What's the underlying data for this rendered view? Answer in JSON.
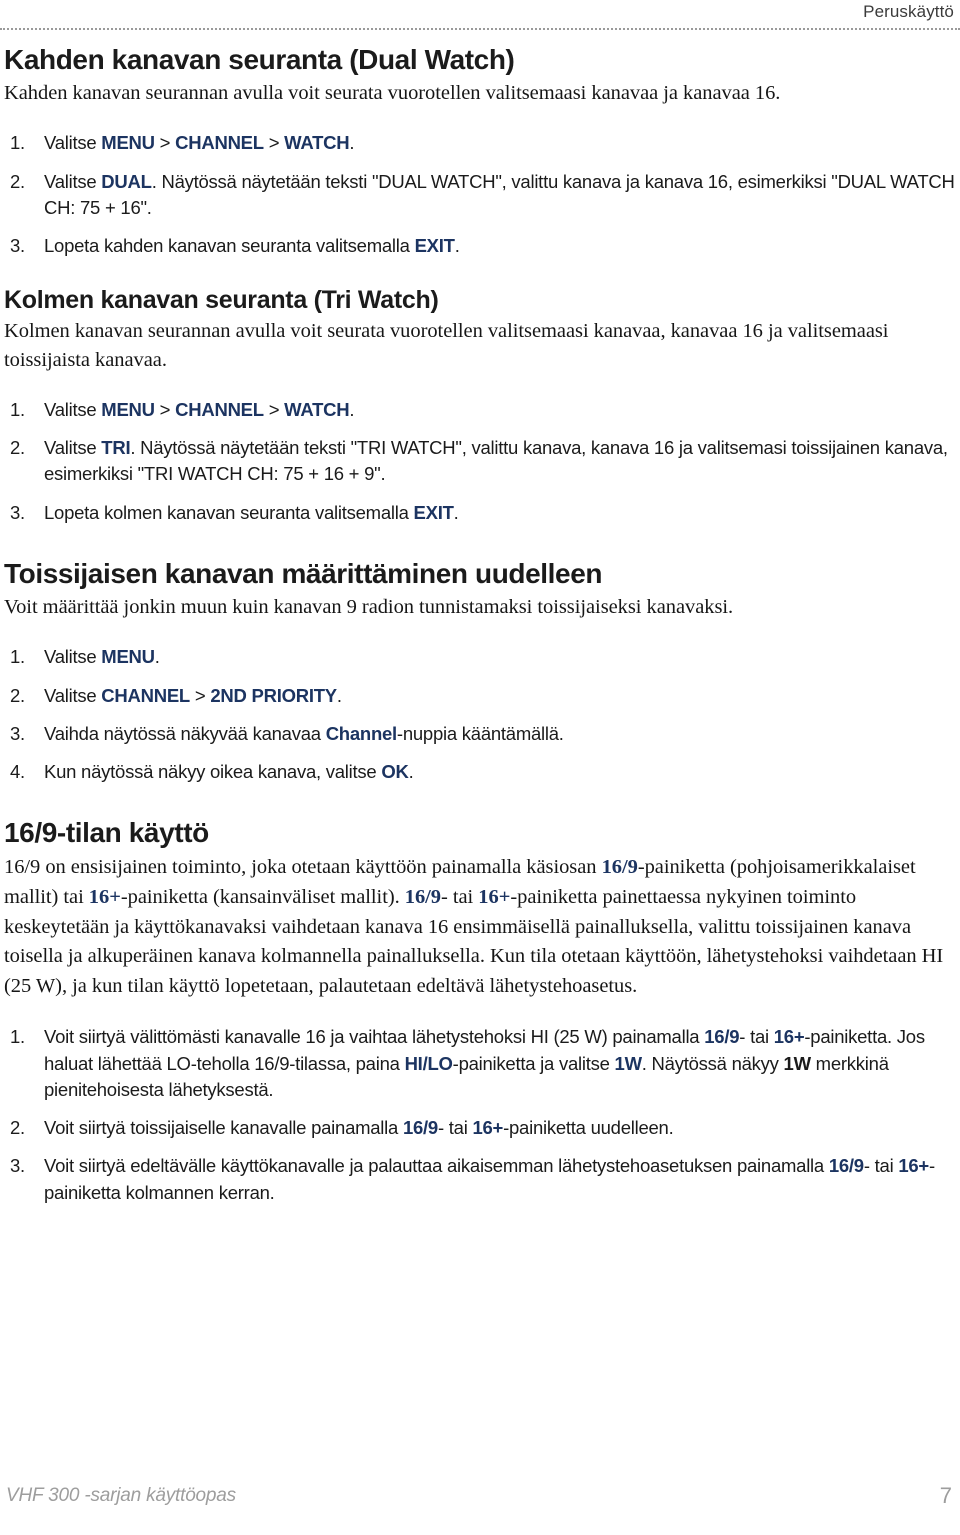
{
  "header": {
    "section_label": "Peruskäyttö"
  },
  "colors": {
    "keyword_blue": "#1c3461",
    "heading_black": "#1b1b1b",
    "footer_gray": "#9d9d9d",
    "rule_gray": "#9a9a9a"
  },
  "sections": [
    {
      "heading": "Kahden kanavan seuranta (Dual Watch)",
      "lead": "Kahden kanavan seurannan avulla voit seurata vuorotellen valitsemaasi kanavaa ja kanavaa 16.",
      "steps": [
        {
          "num": "1.",
          "parts": [
            {
              "t": "Valitse ",
              "k": false
            },
            {
              "t": "MENU",
              "k": true
            },
            {
              "t": " > ",
              "k": false
            },
            {
              "t": "CHANNEL",
              "k": true
            },
            {
              "t": " > ",
              "k": false
            },
            {
              "t": "WATCH",
              "k": true
            },
            {
              "t": ".",
              "k": false
            }
          ]
        },
        {
          "num": "2.",
          "parts": [
            {
              "t": "Valitse ",
              "k": false
            },
            {
              "t": "DUAL",
              "k": true
            },
            {
              "t": ". Näytössä näytetään teksti \"DUAL WATCH\", valittu kanava ja kanava 16, esimerkiksi \"DUAL WATCH CH: 75 + 16\".",
              "k": false
            }
          ]
        },
        {
          "num": "3.",
          "parts": [
            {
              "t": "Lopeta kahden kanavan seuranta valitsemalla ",
              "k": false
            },
            {
              "t": "EXIT",
              "k": true
            },
            {
              "t": ".",
              "k": false
            }
          ]
        }
      ]
    },
    {
      "heading": "Kolmen kanavan seuranta (Tri Watch)",
      "lead": "Kolmen kanavan seurannan avulla voit seurata vuorotellen valitsemaasi kanavaa, kanavaa 16 ja valitsemaasi toissijaista kanavaa.",
      "steps": [
        {
          "num": "1.",
          "parts": [
            {
              "t": "Valitse ",
              "k": false
            },
            {
              "t": "MENU",
              "k": true
            },
            {
              "t": " > ",
              "k": false
            },
            {
              "t": "CHANNEL",
              "k": true
            },
            {
              "t": " > ",
              "k": false
            },
            {
              "t": "WATCH",
              "k": true
            },
            {
              "t": ".",
              "k": false
            }
          ]
        },
        {
          "num": "2.",
          "parts": [
            {
              "t": "Valitse ",
              "k": false
            },
            {
              "t": "TRI",
              "k": true
            },
            {
              "t": ". Näytössä näytetään teksti \"TRI WATCH\", valittu kanava, kanava 16 ja valitsemasi toissijainen kanava, esimerkiksi \"TRI WATCH CH: 75 + 16 + 9\".",
              "k": false
            }
          ]
        },
        {
          "num": "3.",
          "parts": [
            {
              "t": "Lopeta kolmen kanavan seuranta valitsemalla ",
              "k": false
            },
            {
              "t": "EXIT",
              "k": true
            },
            {
              "t": ".",
              "k": false
            }
          ]
        }
      ]
    },
    {
      "heading": "Toissijaisen kanavan määrittäminen uudelleen",
      "lead": "Voit määrittää jonkin muun kuin kanavan 9 radion tunnistamaksi toissijaiseksi kanavaksi.",
      "steps": [
        {
          "num": "1.",
          "parts": [
            {
              "t": "Valitse ",
              "k": false
            },
            {
              "t": "MENU",
              "k": true
            },
            {
              "t": ".",
              "k": false
            }
          ]
        },
        {
          "num": "2.",
          "parts": [
            {
              "t": "Valitse ",
              "k": false
            },
            {
              "t": "CHANNEL",
              "k": true
            },
            {
              "t": " > ",
              "k": false
            },
            {
              "t": "2ND PRIORITY",
              "k": true
            },
            {
              "t": ".",
              "k": false
            }
          ]
        },
        {
          "num": "3.",
          "parts": [
            {
              "t": "Vaihda näytössä näkyvää kanavaa ",
              "k": false
            },
            {
              "t": "Channel",
              "k": true
            },
            {
              "t": "-nuppia kääntämällä.",
              "k": false
            }
          ]
        },
        {
          "num": "4.",
          "parts": [
            {
              "t": "Kun näytössä näkyy oikea kanava, valitse ",
              "k": false
            },
            {
              "t": "OK",
              "k": true
            },
            {
              "t": ".",
              "k": false
            }
          ]
        }
      ]
    },
    {
      "heading": "16/9-tilan käyttö",
      "paragraph_parts": [
        {
          "t": "16/9 on ensisijainen toiminto, joka otetaan käyttöön painamalla käsiosan ",
          "k": false
        },
        {
          "t": "16/9",
          "k": true
        },
        {
          "t": "-painiketta (pohjoisamerikkalaiset mallit) tai ",
          "k": false
        },
        {
          "t": "16+",
          "k": true
        },
        {
          "t": "-painiketta (kansainväliset mallit). ",
          "k": false
        },
        {
          "t": "16/9",
          "k": true
        },
        {
          "t": "- tai ",
          "k": false
        },
        {
          "t": "16+",
          "k": true
        },
        {
          "t": "-painiketta painettaessa nykyinen toiminto keskeytetään ja käyttökanavaksi vaihdetaan kanava 16 ensimmäisellä painalluksella, valittu toissijainen kanava toisella ja alkuperäinen kanava kolmannella painalluksella. Kun tila otetaan käyttöön, lähetystehoksi vaihdetaan HI (25 W), ja kun tilan käyttö lopetetaan, palautetaan edeltävä lähetystehoasetus.",
          "k": false
        }
      ],
      "steps": [
        {
          "num": "1.",
          "parts": [
            {
              "t": "Voit siirtyä välittömästi kanavalle 16 ja vaihtaa lähetystehoksi HI (25 W) painamalla ",
              "k": false
            },
            {
              "t": "16/9",
              "k": true
            },
            {
              "t": "- tai ",
              "k": false
            },
            {
              "t": "16+",
              "k": true
            },
            {
              "t": "-painiketta. Jos haluat lähettää LO-teholla 16/9-tilassa, paina ",
              "k": false
            },
            {
              "t": "HI/LO",
              "k": true
            },
            {
              "t": "-painiketta ja valitse ",
              "k": false
            },
            {
              "t": "1W",
              "k": true
            },
            {
              "t": ". Näytössä näkyy ",
              "k": false
            },
            {
              "t": "1W",
              "k": false,
              "n": true
            },
            {
              "t": " merkkinä pienitehoisesta lähetyksestä.",
              "k": false
            }
          ]
        },
        {
          "num": "2.",
          "parts": [
            {
              "t": "Voit siirtyä toissijaiselle kanavalle painamalla ",
              "k": false
            },
            {
              "t": "16/9",
              "k": true
            },
            {
              "t": "- tai ",
              "k": false
            },
            {
              "t": "16+",
              "k": true
            },
            {
              "t": "-painiketta uudelleen.",
              "k": false
            }
          ]
        },
        {
          "num": "3.",
          "parts": [
            {
              "t": "Voit siirtyä edeltävälle käyttökanavalle ja palauttaa aikaisemman lähetystehoasetuksen painamalla ",
              "k": false
            },
            {
              "t": "16/9",
              "k": true
            },
            {
              "t": "- tai ",
              "k": false
            },
            {
              "t": "16+",
              "k": true
            },
            {
              "t": "-painiketta kolmannen kerran.",
              "k": false
            }
          ]
        }
      ]
    }
  ],
  "footer": {
    "manual_title": "VHF 300 -sarjan käyttöopas",
    "page_number": "7"
  }
}
